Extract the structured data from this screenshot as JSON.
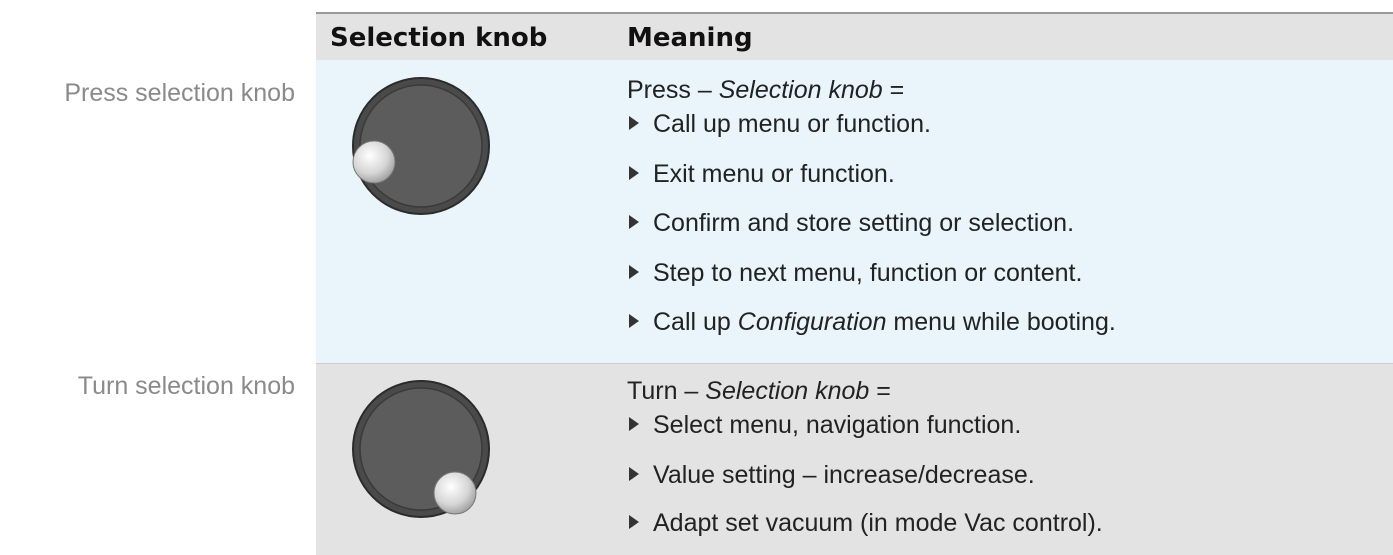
{
  "labels": {
    "press": "Press selection knob",
    "turn": "Turn selection knob"
  },
  "table": {
    "header": {
      "col1": "Selection knob",
      "col2": "Meaning"
    },
    "press": {
      "title_prefix": "Press – ",
      "title_italic": "Selection knob",
      "title_suffix": " =",
      "items": [
        "Call up menu or function.",
        "Exit menu or function.",
        "Confirm and store setting or selection.",
        "Step to next menu, function or content."
      ],
      "last_item": {
        "prefix": "Call up ",
        "italic": "Configuration",
        "suffix": " menu while booting."
      }
    },
    "turn": {
      "title_prefix": "Turn – ",
      "title_italic": "Selection knob",
      "title_suffix": " =",
      "items": [
        "Select menu, navigation function.",
        "Value setting – increase/decrease.",
        "Adapt set vacuum (in mode Vac control)."
      ]
    }
  },
  "colors": {
    "press_row_bg": "#e9f4fb",
    "turn_row_bg": "#e3e3e3",
    "header_bg": "#e3e3e3",
    "label_text": "#8a8a8a",
    "knob_body": "#5a5a5a"
  },
  "icons": {
    "press_knob": "knob-press-icon",
    "turn_knob": "knob-turn-icon",
    "bullet": "triangle-bullet-icon"
  }
}
